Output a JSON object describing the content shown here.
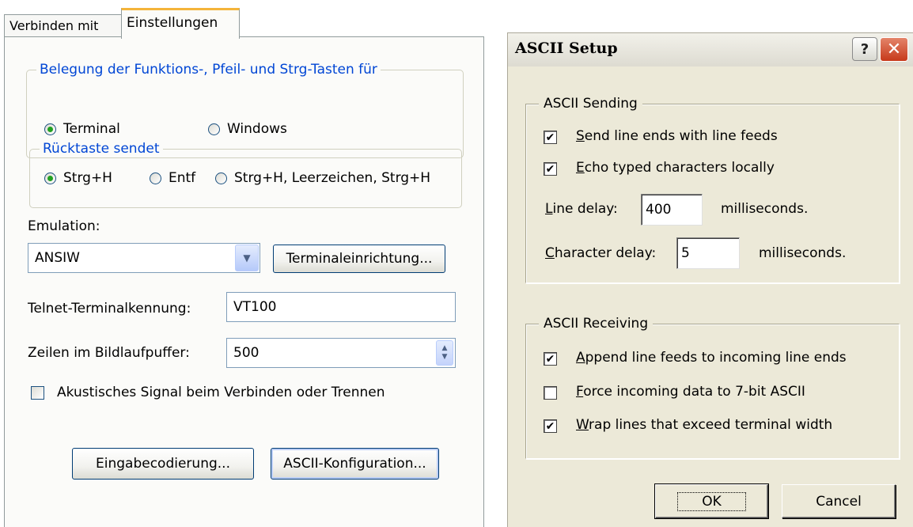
{
  "left_panel": {
    "tabs": [
      {
        "label": "Verbinden mit",
        "active": false
      },
      {
        "label": "Einstellungen",
        "active": true
      }
    ],
    "keys_group": {
      "legend": "Belegung der Funktions-, Pfeil- und Strg-Tasten für",
      "options": [
        {
          "label": "Terminal",
          "selected": true
        },
        {
          "label": "Windows",
          "selected": false
        }
      ]
    },
    "backspace_group": {
      "legend": "Rücktaste sendet",
      "options": [
        {
          "label": "Strg+H",
          "selected": true
        },
        {
          "label": "Entf",
          "selected": false
        },
        {
          "label": "Strg+H, Leerzeichen, Strg+H",
          "selected": false
        }
      ]
    },
    "emulation": {
      "label": "Emulation:",
      "value": "ANSIW",
      "setup_button": "Terminaleinrichtung..."
    },
    "telnet": {
      "label": "Telnet-Terminalkennung:",
      "value": "VT100"
    },
    "scrollback": {
      "label": "Zeilen im Bildlaufpuffer:",
      "value": "500"
    },
    "beep": {
      "label": "Akustisches Signal beim Verbinden oder Trennen",
      "checked": false
    },
    "buttons": {
      "input_encoding": "Eingabecodierung...",
      "ascii_config": "ASCII-Konfiguration..."
    }
  },
  "ascii_dialog": {
    "title": "ASCII Setup",
    "help_glyph": "?",
    "close_glyph": "✕",
    "sending": {
      "legend": "ASCII Sending",
      "send_line_feeds": {
        "mnemonic": "S",
        "rest": "end line ends with line feeds",
        "checked": true
      },
      "echo_locally": {
        "mnemonic": "E",
        "rest": "cho typed characters locally",
        "checked": true
      },
      "line_delay": {
        "mnemonic": "L",
        "rest": "ine delay:",
        "value": "400",
        "unit": "milliseconds."
      },
      "char_delay": {
        "mnemonic": "C",
        "rest": "haracter delay:",
        "value": "5",
        "unit": "milliseconds."
      }
    },
    "receiving": {
      "legend": "ASCII Receiving",
      "append_line_feeds": {
        "mnemonic": "A",
        "rest": "ppend line feeds to incoming line ends",
        "checked": true
      },
      "force_7bit": {
        "mnemonic": "F",
        "rest": "orce incoming data to 7-bit ASCII",
        "checked": false
      },
      "wrap_lines": {
        "mnemonic": "W",
        "rest": "rap lines that exceed terminal width",
        "checked": true
      }
    },
    "ok_label": "OK",
    "cancel_label": "Cancel",
    "check_glyph": "✔"
  },
  "colors": {
    "xp_legend_blue": "#0046d5",
    "radio_selected_green": "#21a121",
    "tab_highlight": "#f4b43a",
    "dialog_face": "#ece9d8",
    "close_red": "#c7391a"
  }
}
